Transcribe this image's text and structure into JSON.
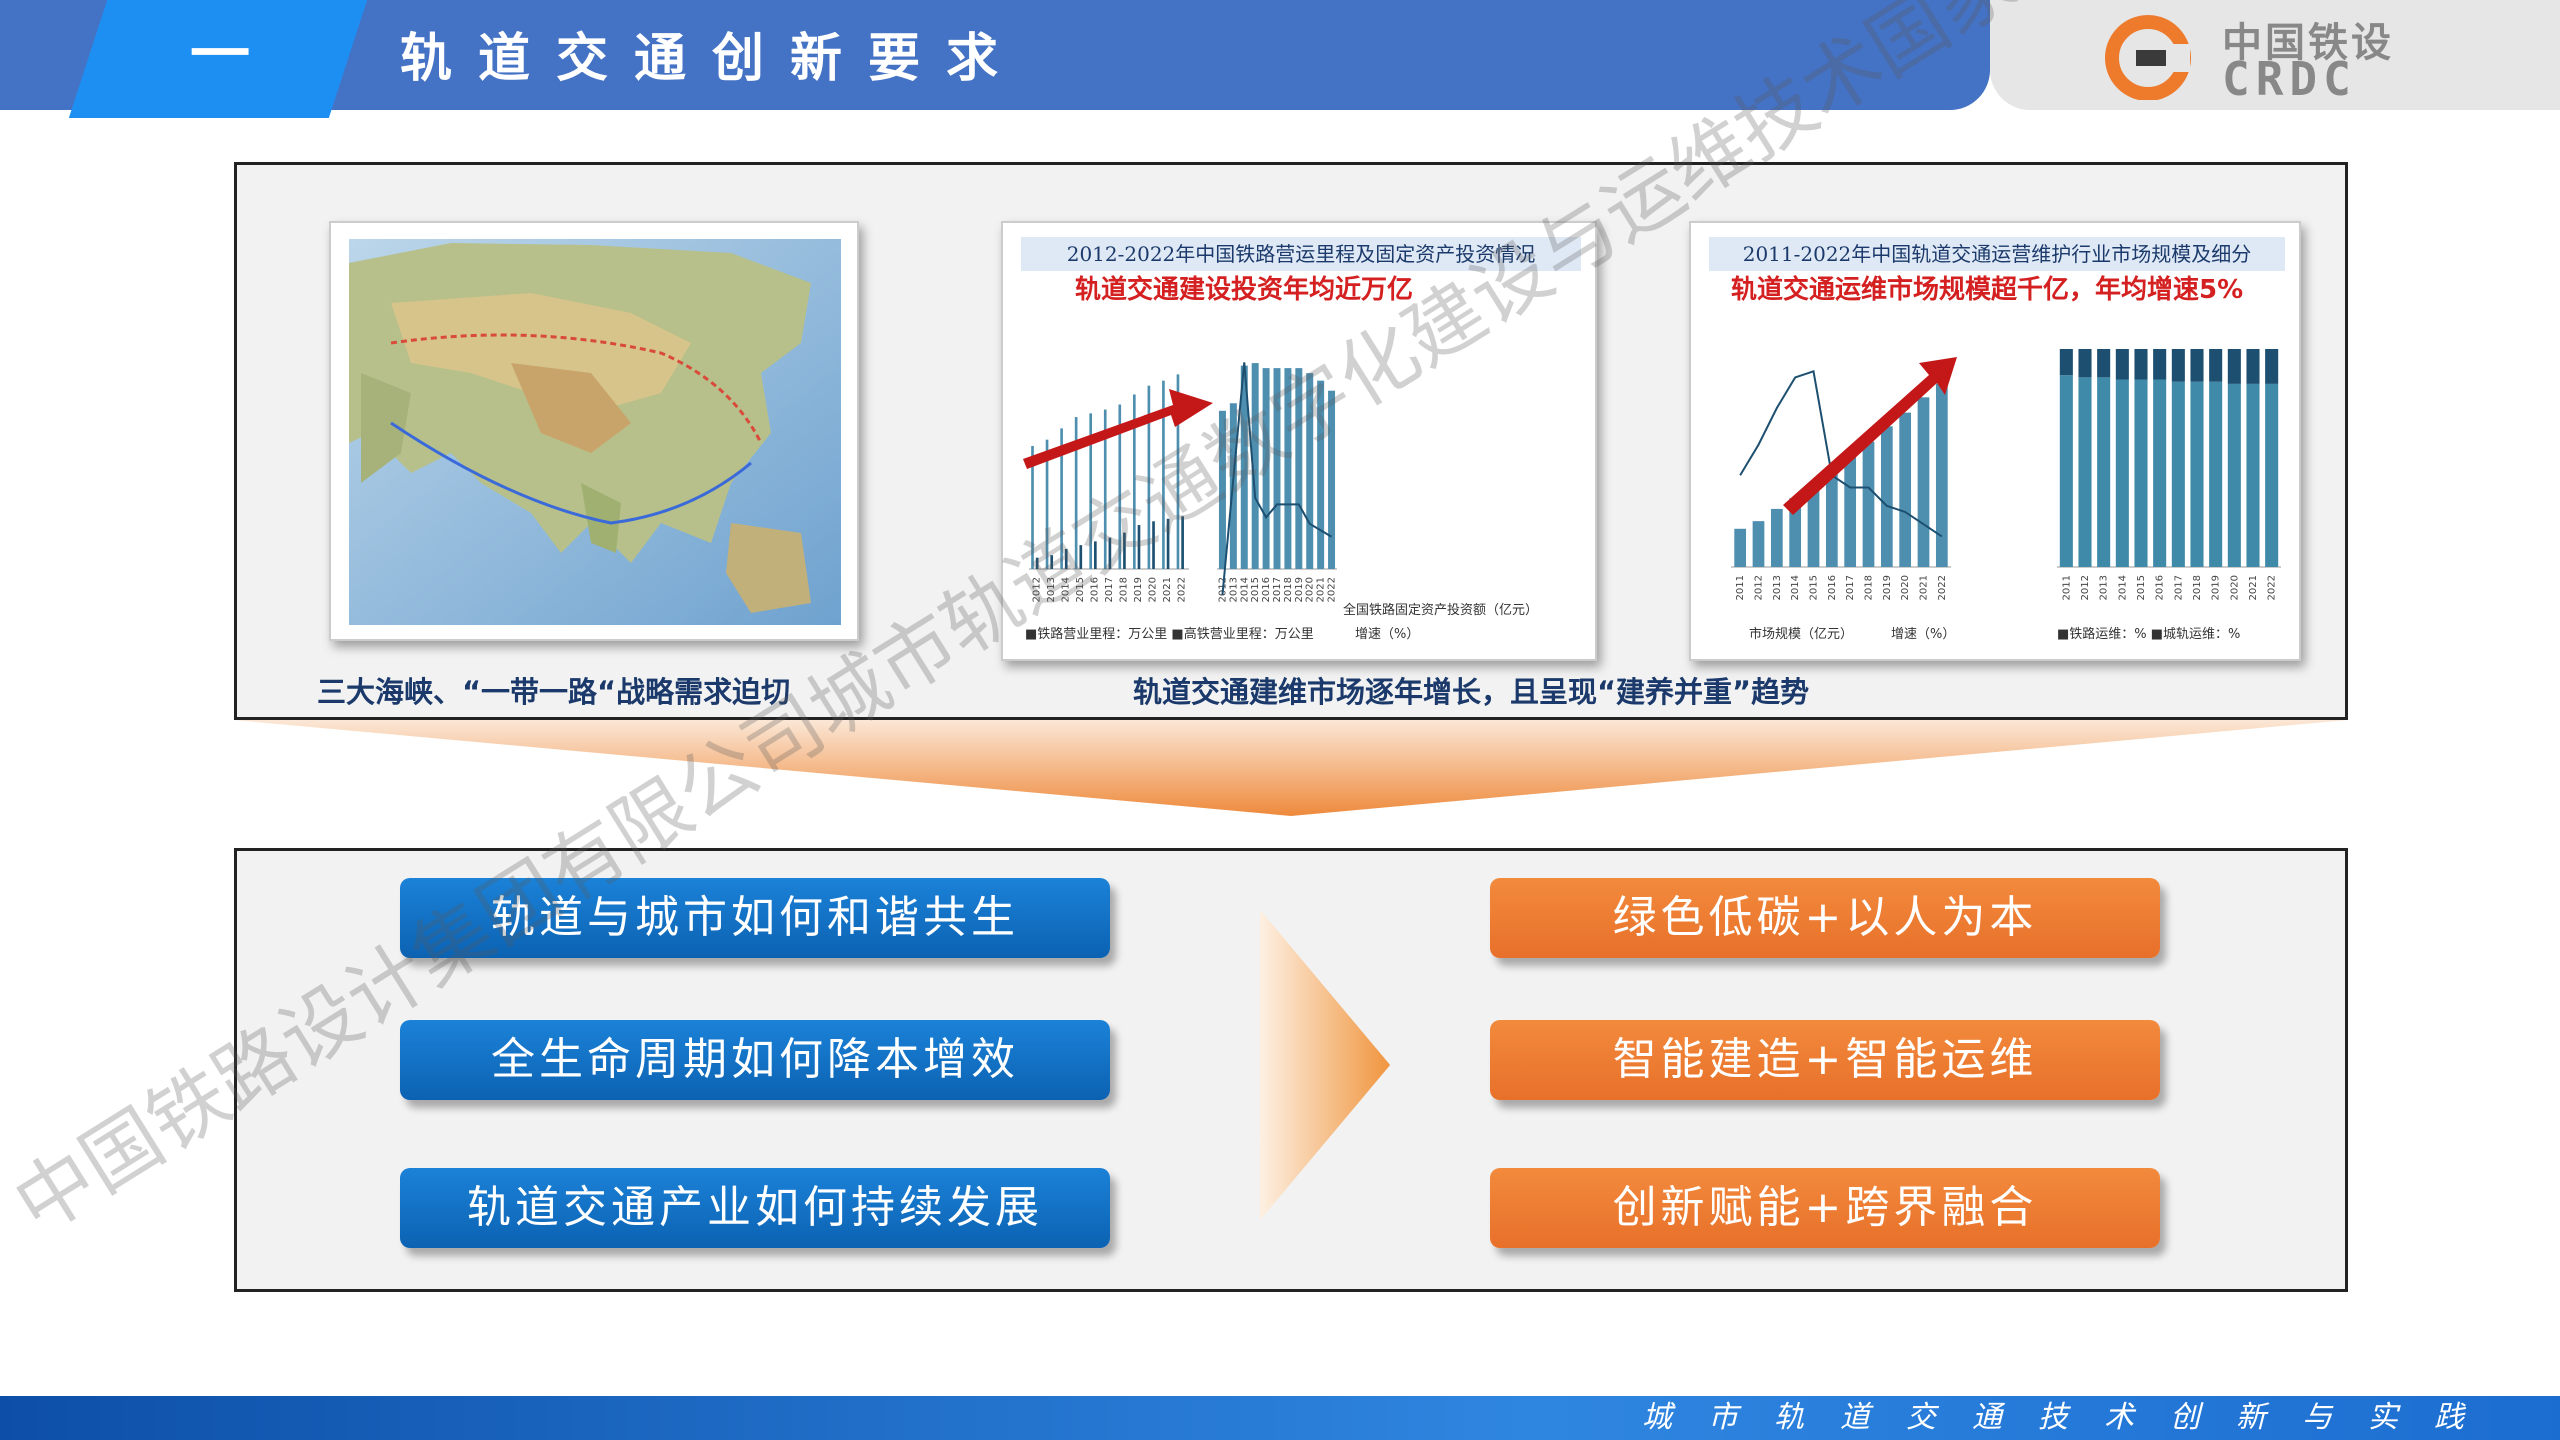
{
  "header": {
    "section_number": "一",
    "section_title": "轨道交通创新要求",
    "logo_cn": "中国铁设",
    "logo_en": "CRDC"
  },
  "top_panel": {
    "map_caption": "三大海峡、“一带一路“战略需求迫切",
    "charts_caption": "轨道交通建维市场逐年增长，且呈现“建养并重”趋势",
    "chart1": {
      "title": "2012-2022年中国铁路营运里程及固定资产投资情况",
      "highlight": "轨道交通建设投资年均近万亿",
      "legend_left": "■铁路营业里程：万公里  ■高铁营业里程：万公里",
      "legend_right_a": "全国铁路固定资产投资额（亿元）",
      "legend_right_b": "增速（%）"
    },
    "chart2": {
      "title": "2011-2022年中国轨道交通运营维护行业市场规模及细分",
      "highlight": "轨道交通运维市场规模超千亿，年均增速5%",
      "legend_left_a": "市场规模（亿元）",
      "legend_left_b": "增速（%）",
      "legend_right": "■铁路运维：%  ■城轨运维：%"
    }
  },
  "chart_data": [
    {
      "type": "bar",
      "title": "2012-2022年中国铁路营运里程及固定资产投资情况",
      "categories": [
        "2012",
        "2013",
        "2014",
        "2015",
        "2016",
        "2017",
        "2018",
        "2019",
        "2020",
        "2021",
        "2022"
      ],
      "series": [
        {
          "name": "铁路营业里程：万公里",
          "values": [
            9.8,
            10.3,
            11.2,
            12.1,
            12.4,
            12.7,
            13.1,
            13.9,
            14.6,
            15.0,
            15.5
          ]
        },
        {
          "name": "高铁营业里程：万公里",
          "values": [
            0.9,
            1.1,
            1.6,
            1.9,
            2.2,
            2.5,
            2.9,
            3.5,
            3.8,
            4.0,
            4.2
          ]
        }
      ],
      "ylim": [
        0,
        18
      ]
    },
    {
      "type": "bar",
      "categories": [
        "2012",
        "2013",
        "2014",
        "2015",
        "2016",
        "2017",
        "2018",
        "2019",
        "2020",
        "2021",
        "2022"
      ],
      "series": [
        {
          "name": "全国铁路固定资产投资额（亿元）",
          "values": [
            6300,
            6600,
            8100,
            8200,
            8000,
            8000,
            8000,
            8000,
            7800,
            7500,
            7100
          ]
        },
        {
          "name": "增速（%）",
          "values": [
            -14,
            4,
            22,
            1,
            -2,
            0,
            0,
            0,
            -3,
            -4,
            -5
          ]
        }
      ],
      "ylim": [
        0,
        9000
      ]
    },
    {
      "type": "bar",
      "title": "2011-2022年中国轨道交通运营维护行业市场规模及细分",
      "categories": [
        "2011",
        "2012",
        "2013",
        "2014",
        "2015",
        "2016",
        "2017",
        "2018",
        "2019",
        "2020",
        "2021",
        "2022"
      ],
      "series": [
        {
          "name": "市场规模（亿元）",
          "values": [
            250,
            300,
            380,
            450,
            550,
            640,
            720,
            820,
            920,
            1010,
            1110,
            1200
          ]
        },
        {
          "name": "增速（%）",
          "values": [
            15,
            20,
            26,
            31,
            32,
            15,
            13,
            13,
            10,
            9,
            7,
            5
          ]
        }
      ],
      "ylim": [
        0,
        1400
      ]
    },
    {
      "type": "bar",
      "categories": [
        "2011",
        "2012",
        "2013",
        "2014",
        "2015",
        "2016",
        "2017",
        "2018",
        "2019",
        "2020",
        "2021",
        "2022"
      ],
      "series": [
        {
          "name": "铁路运维：%",
          "values": [
            88,
            87,
            87,
            86,
            86,
            86,
            85,
            85,
            85,
            84,
            84,
            84
          ]
        },
        {
          "name": "城轨运维：%",
          "values": [
            12,
            13,
            13,
            14,
            14,
            14,
            15,
            15,
            15,
            16,
            16,
            16
          ]
        }
      ],
      "ylim": [
        0,
        100
      ]
    }
  ],
  "requirements": {
    "left": [
      "轨道与城市如何和谐共生",
      "全生命周期如何降本增效",
      "轨道交通产业如何持续发展"
    ],
    "right": [
      "绿色低碳+以人为本",
      "智能建造+智能运维",
      "创新赋能+跨界融合"
    ]
  },
  "footer": {
    "tagline": "城市轨道交通技术创新与实践"
  },
  "watermarks": [
    "中国铁路设计集团有限公司城市轨道交通数字化建设与运维技术国家工程研究中心粤港澳大湾区分中心"
  ],
  "colors": {
    "header_blue": "#4472c4",
    "accent_blue": "#1d8ff2",
    "pill_blue": "#0c62b2",
    "pill_orange": "#e8702a",
    "caption": "#1b3a6b",
    "highlight_red": "#d42020"
  }
}
